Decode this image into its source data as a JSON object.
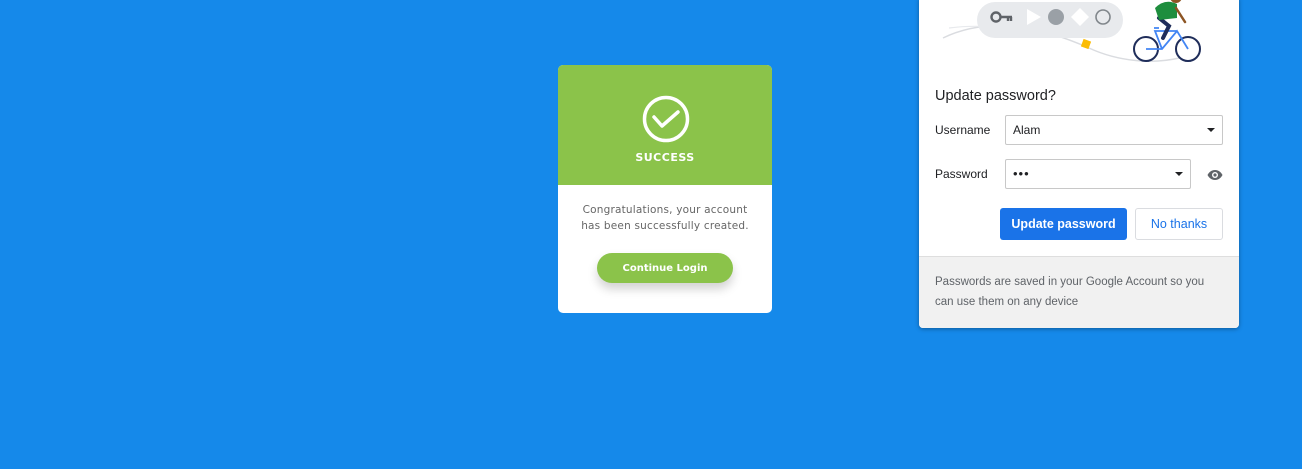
{
  "colors": {
    "background": "#1589ea",
    "success_green": "#8bc34a",
    "primary_blue": "#1a73e8"
  },
  "success_card": {
    "icon": "check-circle-icon",
    "title": "SUCCESS",
    "message_line1": "Congratulations, your account",
    "message_line2": "has been successfully created.",
    "button_label": "Continue Login"
  },
  "password_popup": {
    "illustration": "key-and-cyclist-illustration",
    "title": "Update password?",
    "username_label": "Username",
    "username_value": "Alam",
    "password_label": "Password",
    "password_value": "•••",
    "show_password_icon": "eye-icon",
    "update_button": "Update password",
    "no_thanks_button": "No thanks",
    "footer_text": "Passwords are saved in your Google Account so you can use them on any device"
  }
}
